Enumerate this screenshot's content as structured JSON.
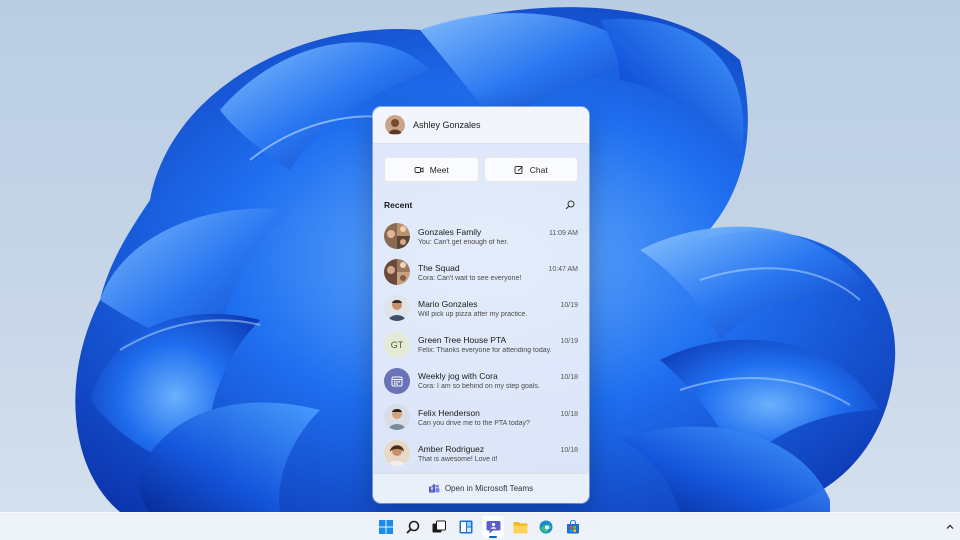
{
  "flyout": {
    "user_name": "Ashley Gonzales",
    "meet_label": "Meet",
    "chat_label": "Chat",
    "recent_title": "Recent",
    "footer_label": "Open in Microsoft Teams",
    "chats": [
      {
        "name": "Gonzales Family",
        "time": "11:09 AM",
        "preview": "You: Can't get enough of her.",
        "avatar": "group-photo"
      },
      {
        "name": "The Squad",
        "time": "10:47 AM",
        "preview": "Cora: Can't wait to see everyone!",
        "avatar": "group-photo"
      },
      {
        "name": "Mario Gonzales",
        "time": "10/19",
        "preview": "Will pick up pizza after my practice.",
        "avatar": "person-photo"
      },
      {
        "name": "Green Tree House PTA",
        "time": "10/19",
        "preview": "Felix: Thanks everyone for attending today.",
        "avatar": "initials",
        "initials": "GT"
      },
      {
        "name": "Weekly jog with Cora",
        "time": "10/18",
        "preview": "Cora: I am so behind on my step goals.",
        "avatar": "calendar-icon"
      },
      {
        "name": "Felix Henderson",
        "time": "10/18",
        "preview": "Can you drive me to the PTA today?",
        "avatar": "person-photo"
      },
      {
        "name": "Amber Rodriguez",
        "time": "10/18",
        "preview": "That is awesome! Love it!",
        "avatar": "person-photo"
      }
    ]
  },
  "taskbar": {
    "icons": [
      "windows-start-icon",
      "search-icon",
      "task-view-icon",
      "widgets-icon",
      "teams-chat-icon",
      "file-explorer-icon",
      "edge-icon",
      "store-icon"
    ],
    "active": "teams-chat-icon"
  },
  "colors": {
    "accent": "#0067c0",
    "teams_purple": "#5b5fc7",
    "wallpaper_blue": "#1a5ee0"
  }
}
